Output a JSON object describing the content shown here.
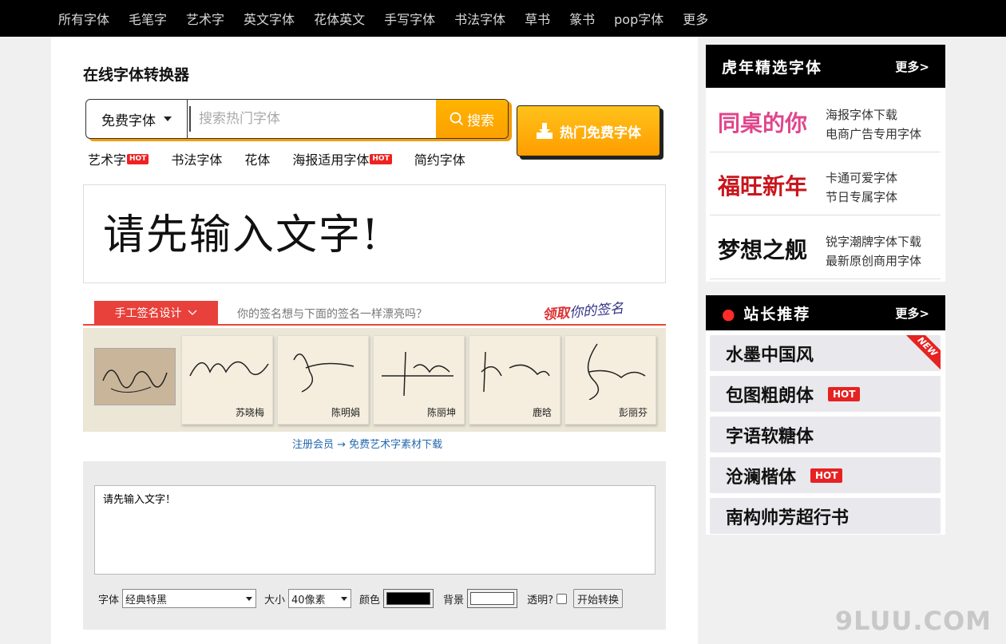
{
  "nav": [
    "所有字体",
    "毛笔字",
    "艺术字",
    "英文字体",
    "花体英文",
    "手写字体",
    "书法字体",
    "草书",
    "篆书",
    "pop字体",
    "更多"
  ],
  "page_title": "在线字体转换器",
  "search": {
    "select_label": "免费字体",
    "placeholder": "搜索热门字体",
    "button_label": "搜索"
  },
  "hot_free_button": "热门免费字体",
  "sublinks": [
    {
      "label": "艺术字",
      "hot": "HOT"
    },
    {
      "label": "书法字体",
      "hot": ""
    },
    {
      "label": "花体",
      "hot": ""
    },
    {
      "label": "海报适用字体",
      "hot": "HOT"
    },
    {
      "label": "简约字体",
      "hot": ""
    }
  ],
  "preview_text": "请先输入文字!",
  "signature": {
    "tab_label": "手工签名设计",
    "question": "你的签名想与下面的签名一样漂亮吗？",
    "claim_a": "领取",
    "claim_b": "你的签名",
    "names": [
      "苏晓梅",
      "陈明娟",
      "陈丽坤",
      "鹿晗",
      "彭丽芬"
    ]
  },
  "register_link": "注册会员 → 免费艺术字素材下载",
  "converter": {
    "text_value": "请先输入文字！",
    "font_label": "字体",
    "font_value": "经典特黑",
    "size_label": "大小",
    "size_value": "40像素",
    "color_label": "颜色",
    "color_value": "#000000",
    "bg_label": "背景",
    "bg_value": "#ffffff",
    "transparent_label": "透明?",
    "convert_button": "开始转换"
  },
  "sidebar": {
    "section1_title": "虎年精选字体",
    "section1_more": "更多>",
    "fonts": [
      {
        "thumb": "同桌的你",
        "l1": "海报字体下载",
        "l2": "电商广告专用字体",
        "color": "#e0468c"
      },
      {
        "thumb": "福旺新年",
        "l1": "卡通可爱字体",
        "l2": "节日专属字体",
        "color": "#c8161d"
      },
      {
        "thumb": "梦想之舰",
        "l1": "锐字潮牌字体下载",
        "l2": "最新原创商用字体",
        "color": "#111111"
      }
    ],
    "section2_title": "站长推荐",
    "section2_more": "更多>",
    "recommend": [
      {
        "label": "水墨中国风",
        "badge": "",
        "ribbon": "NEW"
      },
      {
        "label": "包图粗朗体",
        "badge": "HOT",
        "ribbon": ""
      },
      {
        "label": "字语软糖体",
        "badge": "",
        "ribbon": ""
      },
      {
        "label": "沧澜楷体",
        "badge": "HOT",
        "ribbon": ""
      },
      {
        "label": "南构帅芳超行书",
        "badge": "",
        "ribbon": ""
      }
    ]
  },
  "watermark": "9LUU.COM"
}
